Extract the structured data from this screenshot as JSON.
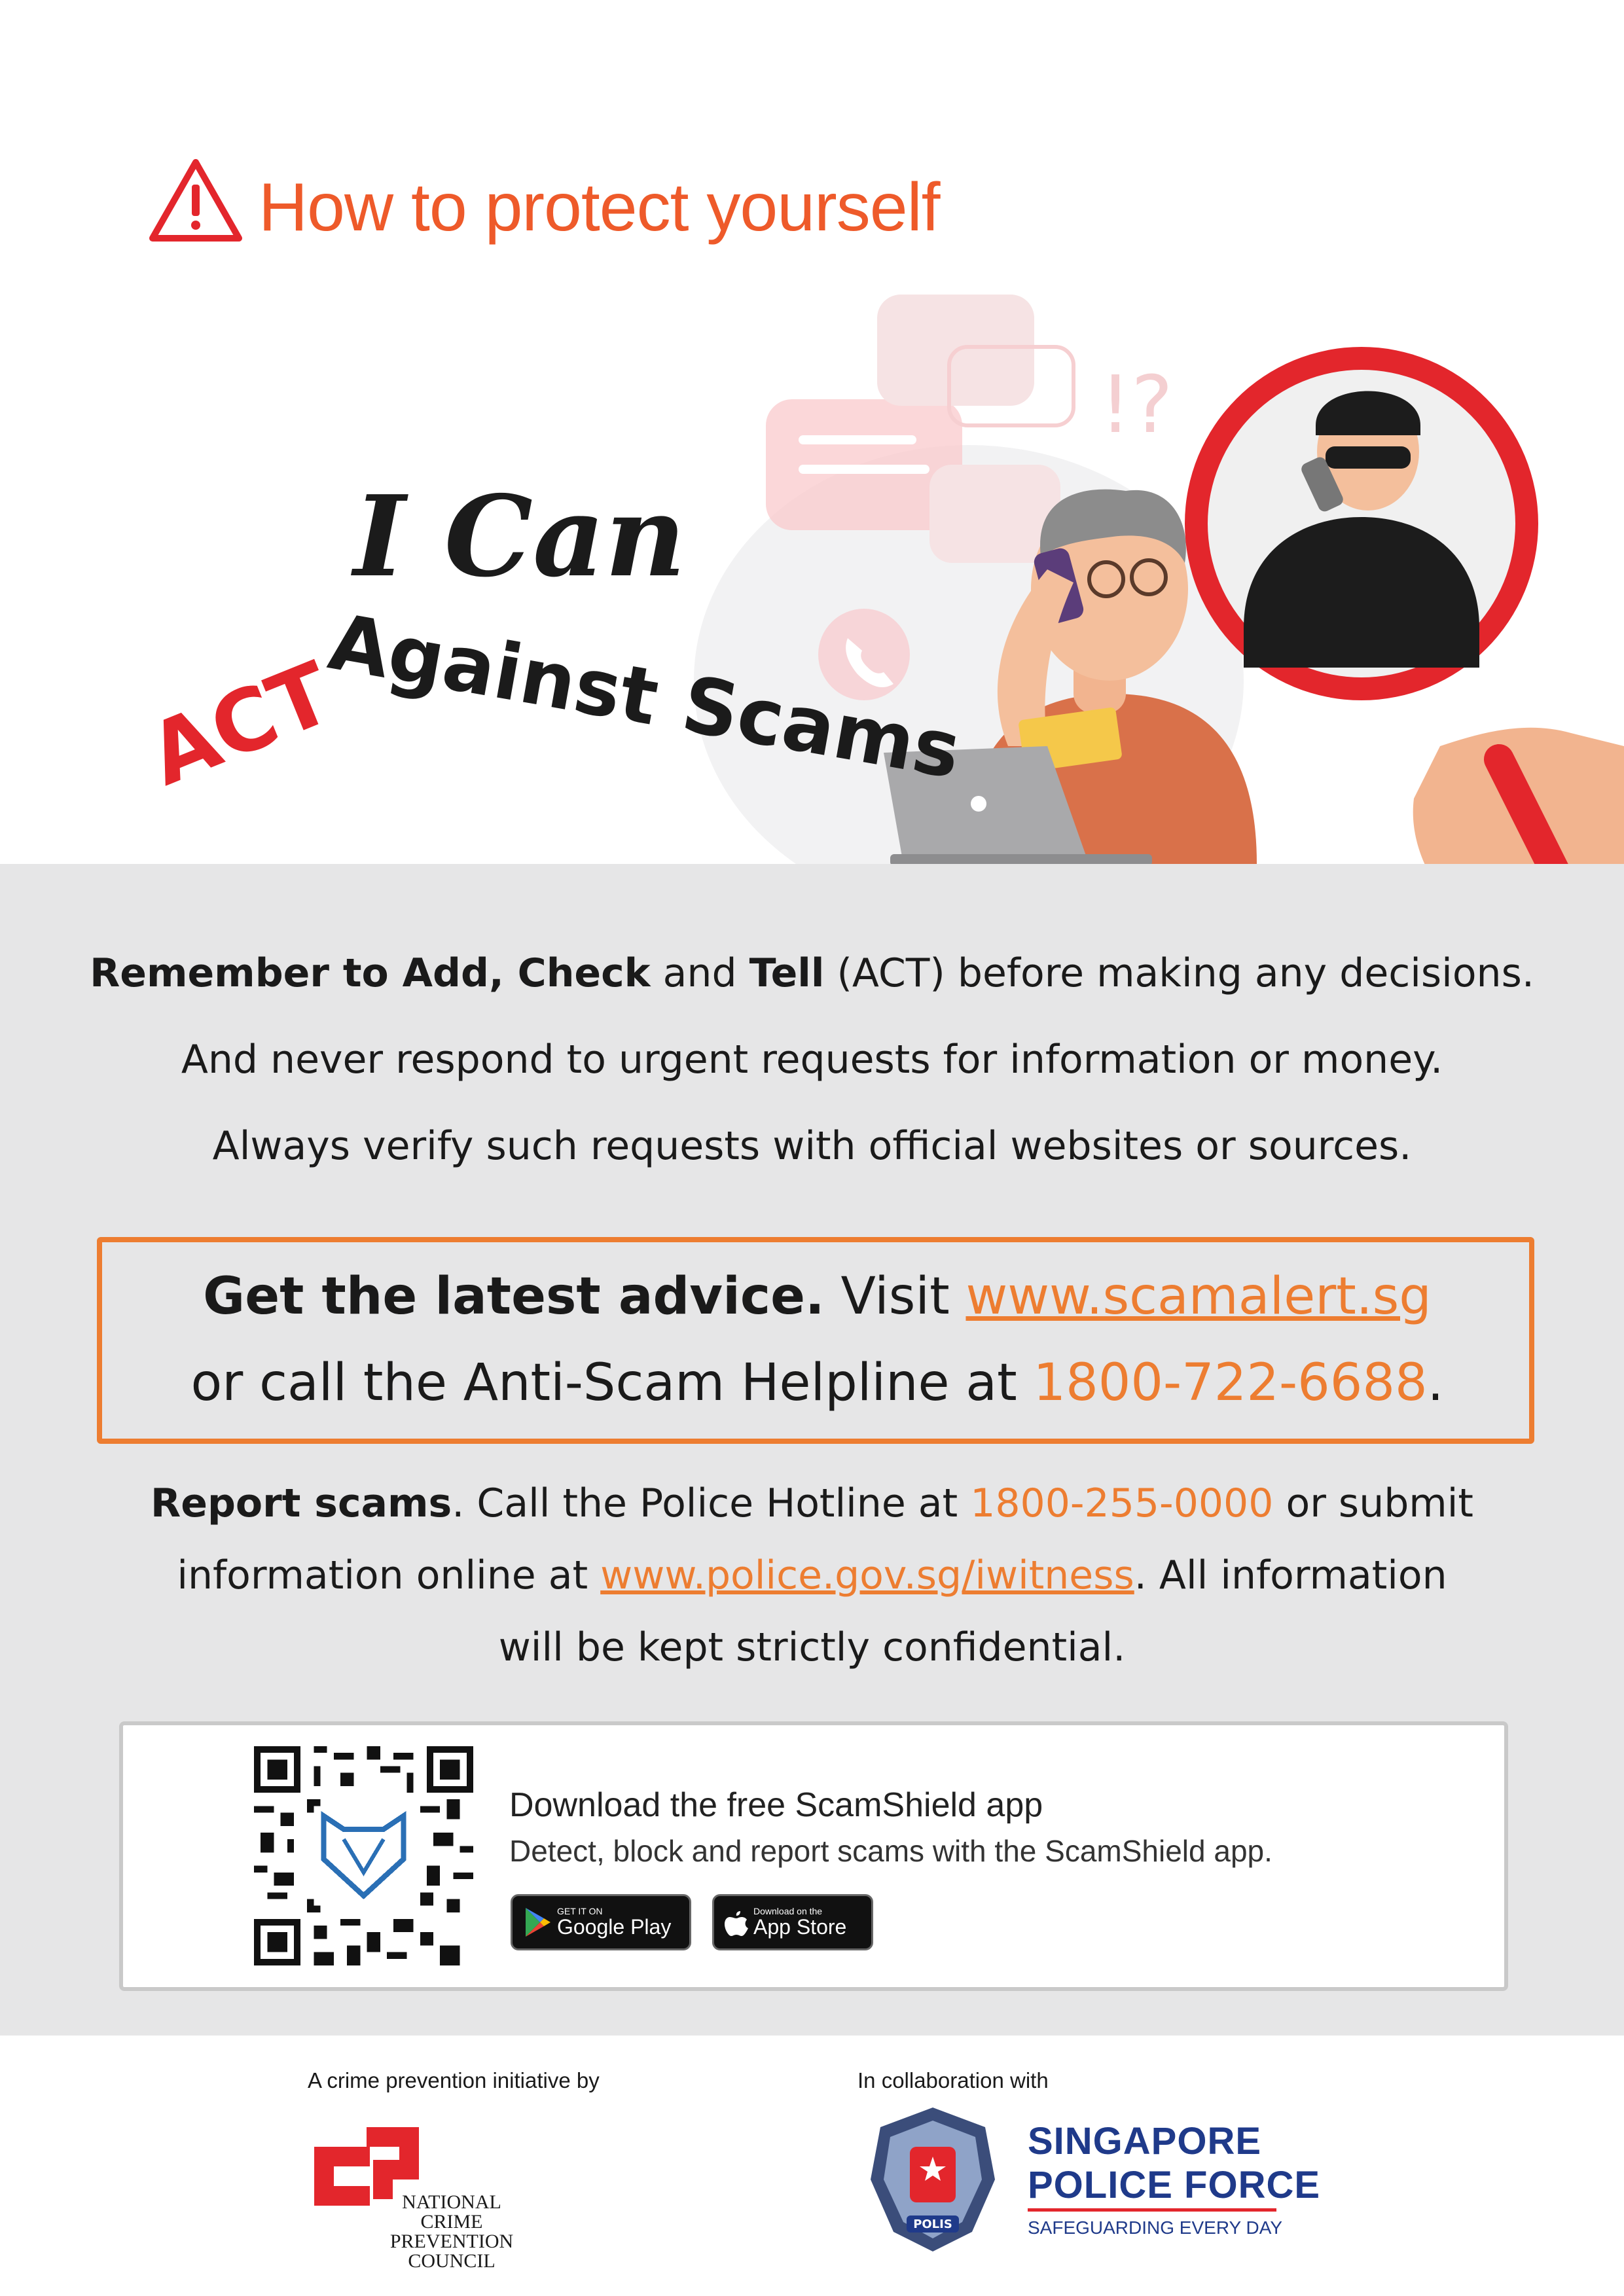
{
  "header": {
    "title": "How to protect yourself",
    "warning_icon": "warning-triangle-icon"
  },
  "hero": {
    "line1": "I Can",
    "act": "ACT",
    "against": "Against Scams",
    "phone_icon": "phone-icon",
    "question_marks": "!?"
  },
  "panel": {
    "line1": {
      "remember": "Remember to ",
      "add": "Add",
      "comma": ", ",
      "check": "Check",
      "and": " and ",
      "tell": "Tell",
      "rest": " (ACT) before making any decisions."
    },
    "line2": "And never respond to urgent requests for information or money.",
    "line3": "Always verify such requests with official websites or sources.",
    "advice": {
      "bold": "Get the latest advice.",
      "visit": " Visit ",
      "url": "www.scamalert.sg",
      "line2_prefix": "or call the Anti-Scam Helpline at ",
      "phone": "1800-722-6688",
      "end": "."
    },
    "report": {
      "bold": "Report scams",
      "t1": ". Call the Police Hotline at ",
      "hotline": "1800-255-0000",
      "t2": " or submit",
      "t3": "information online at ",
      "url": "www.police.gov.sg/iwitness",
      "t4": ". All information",
      "t5": "will be kept strictly confidential."
    },
    "app": {
      "title": "Download the free ScamShield app",
      "subtitle": "Detect, block and report scams with the ScamShield app.",
      "google_small": "GET IT ON",
      "google_big": "Google Play",
      "apple_small": "Download on the",
      "apple_big": "App Store"
    }
  },
  "footer": {
    "left_caption": "A crime prevention initiative by",
    "right_caption": "In collaboration with",
    "ncpc_line1": "NATIONAL",
    "ncpc_line2": "CRIME PREVENTION",
    "ncpc_line3": "COUNCIL",
    "spf_line1": "SINGAPORE",
    "spf_line2": "POLICE FORCE",
    "spf_tagline": "SAFEGUARDING EVERY DAY",
    "crest_text": "POLIS"
  },
  "colors": {
    "accent_orange": "#ed7d31",
    "title_orange": "#ee5a2a",
    "act_red": "#e3262c",
    "panel_grey": "#e6e6e7",
    "spf_blue": "#1f3a8a"
  }
}
